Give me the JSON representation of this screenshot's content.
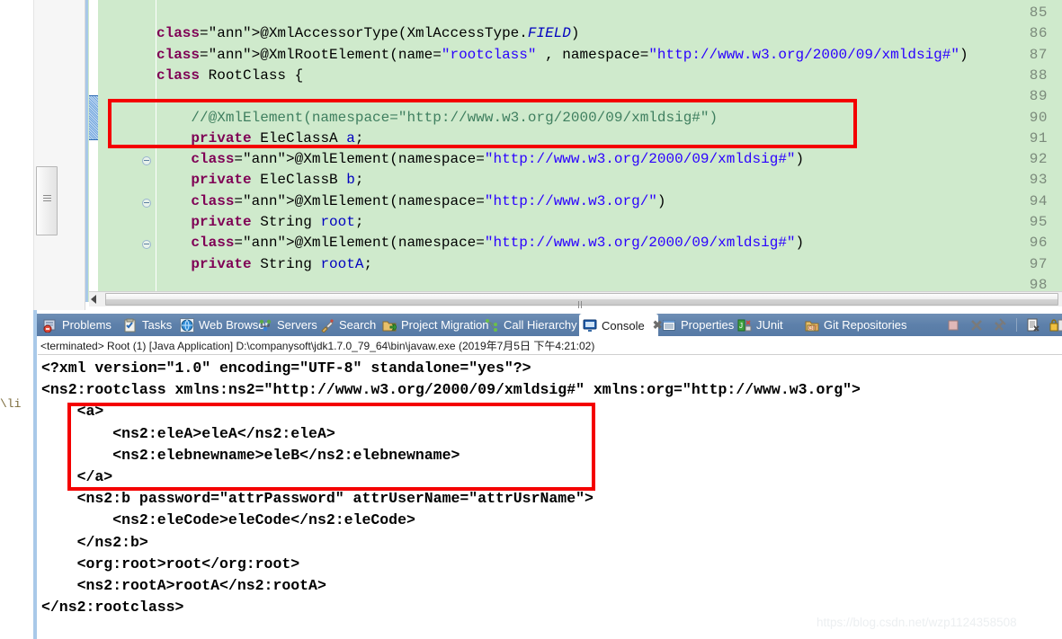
{
  "editor": {
    "background_color": "#cfeacc",
    "first_line_number": 85,
    "lines": [
      {
        "n": "85",
        "fold": false,
        "text": ""
      },
      {
        "n": "86",
        "fold": false,
        "text": "@XmlAccessorType(XmlAccessType.FIELD)"
      },
      {
        "n": "87",
        "fold": false,
        "text": "@XmlRootElement(name=\"rootclass\" , namespace=\"http://www.w3.org/2000/09/xmldsig#\")"
      },
      {
        "n": "88",
        "fold": false,
        "text": "class RootClass {"
      },
      {
        "n": "89",
        "fold": false,
        "text": ""
      },
      {
        "n": "90",
        "fold": false,
        "text": "    //@XmlElement(namespace=\"http://www.w3.org/2000/09/xmldsig#\")"
      },
      {
        "n": "91",
        "fold": false,
        "text": "    private EleClassA a;"
      },
      {
        "n": "92",
        "fold": true,
        "text": "    @XmlElement(namespace=\"http://www.w3.org/2000/09/xmldsig#\")"
      },
      {
        "n": "93",
        "fold": false,
        "text": "    private EleClassB b;"
      },
      {
        "n": "94",
        "fold": true,
        "text": "    @XmlElement(namespace=\"http://www.w3.org/\")"
      },
      {
        "n": "95",
        "fold": false,
        "text": "    private String root;"
      },
      {
        "n": "96",
        "fold": true,
        "text": "    @XmlElement(namespace=\"http://www.w3.org/2000/09/xmldsig#\")"
      },
      {
        "n": "97",
        "fold": false,
        "text": "    private String rootA;"
      },
      {
        "n": "98",
        "fold": false,
        "text": ""
      }
    ],
    "highlight_box_label": "code-highlight-lines-90-91"
  },
  "left_rail": {
    "text_fragment": "\\li"
  },
  "tabs": [
    {
      "label": "Problems",
      "icon": "problems-icon",
      "active": false
    },
    {
      "label": "Tasks",
      "icon": "tasks-icon",
      "active": false
    },
    {
      "label": "Web Browser",
      "icon": "web-browser-icon",
      "active": false
    },
    {
      "label": "Servers",
      "icon": "servers-icon",
      "active": false
    },
    {
      "label": "Search",
      "icon": "search-icon",
      "active": false
    },
    {
      "label": "Project Migration",
      "icon": "project-migration-icon",
      "active": false
    },
    {
      "label": "Call Hierarchy",
      "icon": "call-hierarchy-icon",
      "active": false
    },
    {
      "label": "Console",
      "icon": "console-icon",
      "active": true,
      "close": "✖"
    },
    {
      "label": "Properties",
      "icon": "properties-icon",
      "active": false
    },
    {
      "label": "JUnit",
      "icon": "junit-icon",
      "active": false
    },
    {
      "label": "Git Repositories",
      "icon": "git-repositories-icon",
      "active": false
    }
  ],
  "tab_tools": [
    {
      "name": "terminate-button",
      "icon": "stop-square-icon"
    },
    {
      "name": "remove-launch-button",
      "icon": "remove-x-icon"
    },
    {
      "name": "remove-all-launches-button",
      "icon": "remove-all-x-icon"
    },
    {
      "name": "divider",
      "icon": "divider"
    },
    {
      "name": "open-console-button",
      "icon": "document-icon"
    },
    {
      "name": "pin-console-button",
      "icon": "lock-icon"
    }
  ],
  "console": {
    "status": "<terminated> Root (1) [Java Application] D:\\companysoft\\jdk1.7.0_79_64\\bin\\javaw.exe (2019年7月5日 下午4:21:02)",
    "lines": [
      "<?xml version=\"1.0\" encoding=\"UTF-8\" standalone=\"yes\"?>",
      "<ns2:rootclass xmlns:ns2=\"http://www.w3.org/2000/09/xmldsig#\" xmlns:org=\"http://www.w3.org\">",
      "    <a>",
      "        <ns2:eleA>eleA</ns2:eleA>",
      "        <ns2:elebnewname>eleB</ns2:elebnewname>",
      "    </a>",
      "    <ns2:b password=\"attrPassword\" attrUserName=\"attrUsrName\">",
      "        <ns2:eleCode>eleCode</ns2:eleCode>",
      "    </ns2:b>",
      "    <org:root>root</org:root>",
      "    <ns2:rootA>rootA</ns2:rootA>",
      "</ns2:rootclass>"
    ],
    "highlight_box_label": "console-highlight-a-element"
  },
  "watermark": "https://blog.csdn.net/wzp1124358508",
  "colors": {
    "editor_bg": "#cfeacc",
    "highlight_red": "#f40000",
    "tabbar_blue": "#5d80aa",
    "string_blue": "#2a00ff",
    "keyword_purple": "#7f0055",
    "annotation_gray": "#646464"
  }
}
